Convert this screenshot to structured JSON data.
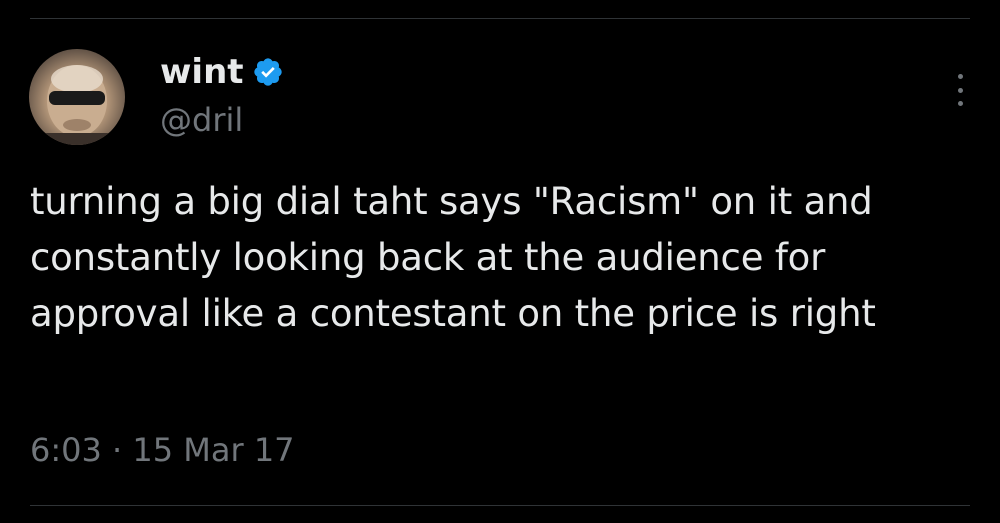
{
  "tweet": {
    "author": {
      "display_name": "wint",
      "handle": "@dril",
      "verified": true,
      "avatar_icon": "avatar-icon"
    },
    "text": "turning a big dial taht says \"Racism\" on it and constantly looking back at the audience for approval like a contestant on the price is right",
    "time": "6:03",
    "separator": "·",
    "date": "15 Mar 17"
  },
  "colors": {
    "background": "#000000",
    "text_primary": "#e7e9ea",
    "text_secondary": "#71767b",
    "verified_blue": "#1d9bf0",
    "divider": "#2f3336"
  }
}
